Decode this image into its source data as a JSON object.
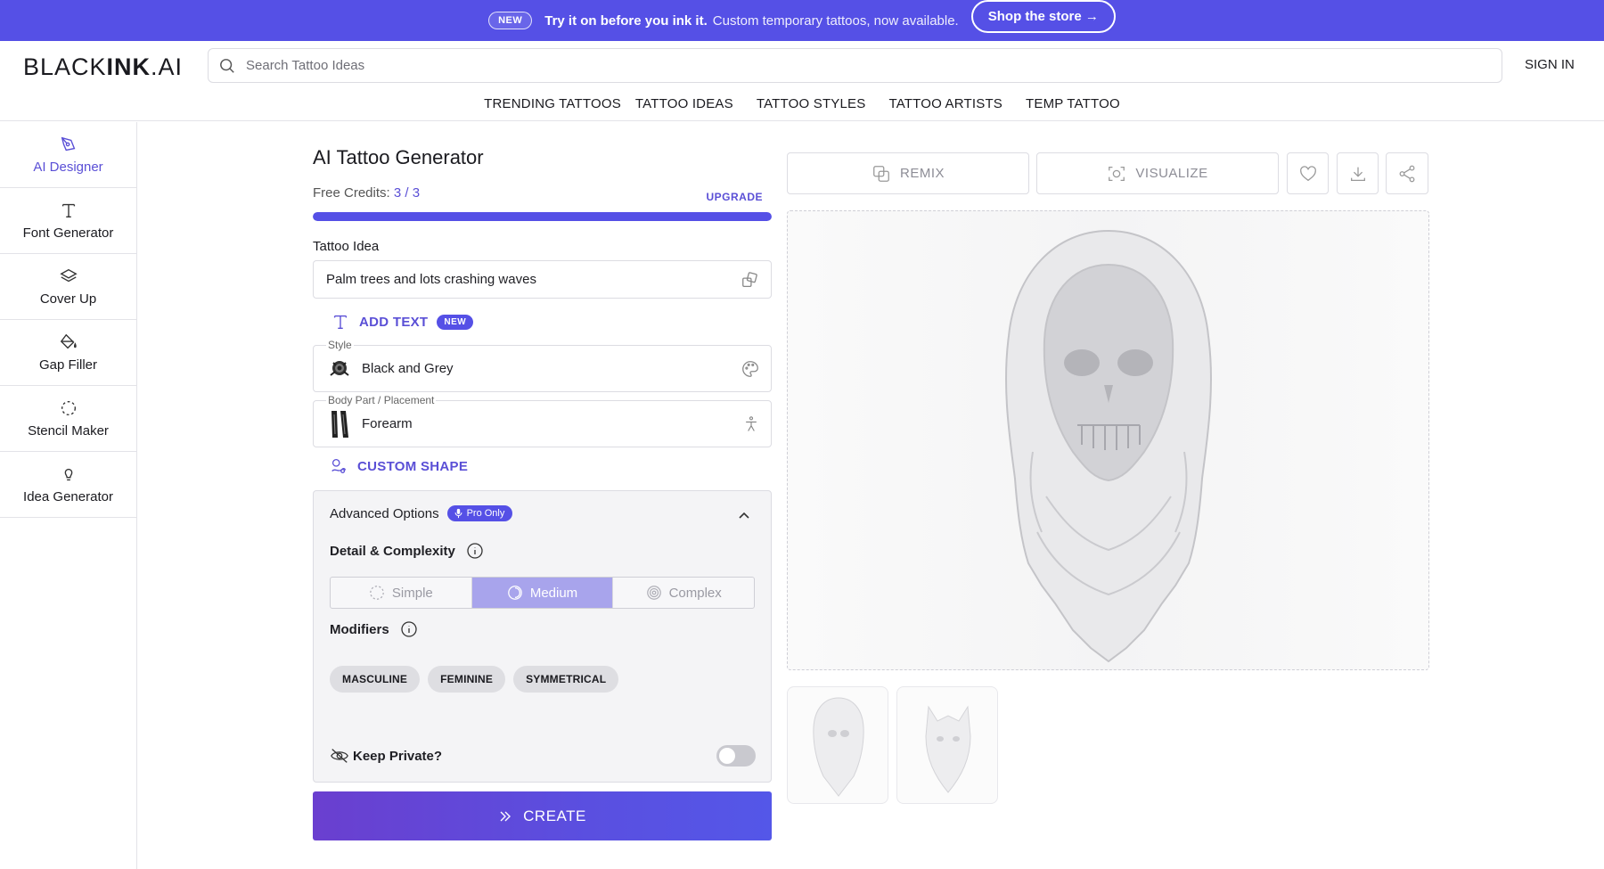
{
  "banner": {
    "badge": "NEW",
    "headline": "Try it on before you ink it.",
    "subtext": "Custom temporary tattoos, now available.",
    "cta": "Shop the store →"
  },
  "header": {
    "logo_thin": "BLACK",
    "logo_bold": "INK",
    "logo_end": ".AI",
    "search_placeholder": "Search Tattoo Ideas",
    "signin": "SIGN IN",
    "nav": [
      "TRENDING TATTOOS",
      "TATTOO IDEAS",
      "TATTOO STYLES",
      "TATTOO ARTISTS",
      "TEMP TATTOO"
    ]
  },
  "sidebar": {
    "items": [
      {
        "label": "AI Designer",
        "icon": "pen-nib-icon",
        "active": true
      },
      {
        "label": "Font Generator",
        "icon": "text-t-icon"
      },
      {
        "label": "Cover Up",
        "icon": "layers-icon"
      },
      {
        "label": "Gap Filler",
        "icon": "paint-bucket-icon"
      },
      {
        "label": "Stencil Maker",
        "icon": "dashed-circle-icon"
      },
      {
        "label": "Idea Generator",
        "icon": "lightbulb-icon"
      }
    ]
  },
  "form": {
    "title": "AI Tattoo Generator",
    "credits_label": "Free Credits:",
    "credits_used": "3",
    "credits_sep": "/",
    "credits_total": "3",
    "credits_fraction": 1.0,
    "upgrade": "UPGRADE",
    "idea_label": "Tattoo Idea",
    "idea_value": "Palm trees and lots crashing waves",
    "add_text": "ADD TEXT",
    "add_text_badge": "NEW",
    "style_label": "Style",
    "style_value": "Black and Grey",
    "placement_label": "Body Part / Placement",
    "placement_value": "Forearm",
    "custom_shape": "CUSTOM SHAPE",
    "create": "CREATE"
  },
  "advanced": {
    "title": "Advanced Options",
    "badge": "Pro Only",
    "detail_label": "Detail & Complexity",
    "complexity_options": [
      "Simple",
      "Medium",
      "Complex"
    ],
    "complexity_selected": "Medium",
    "modifiers_label": "Modifiers",
    "modifiers": [
      "MASCULINE",
      "FEMININE",
      "SYMMETRICAL"
    ],
    "private_label": "Keep Private?",
    "private_on": false
  },
  "toolbar": {
    "remix": "REMIX",
    "visualize": "VISUALIZE"
  },
  "colors": {
    "accent": "#5550e6",
    "accent_text": "#5a4fd6",
    "selected_segment": "#a8a4ec"
  }
}
